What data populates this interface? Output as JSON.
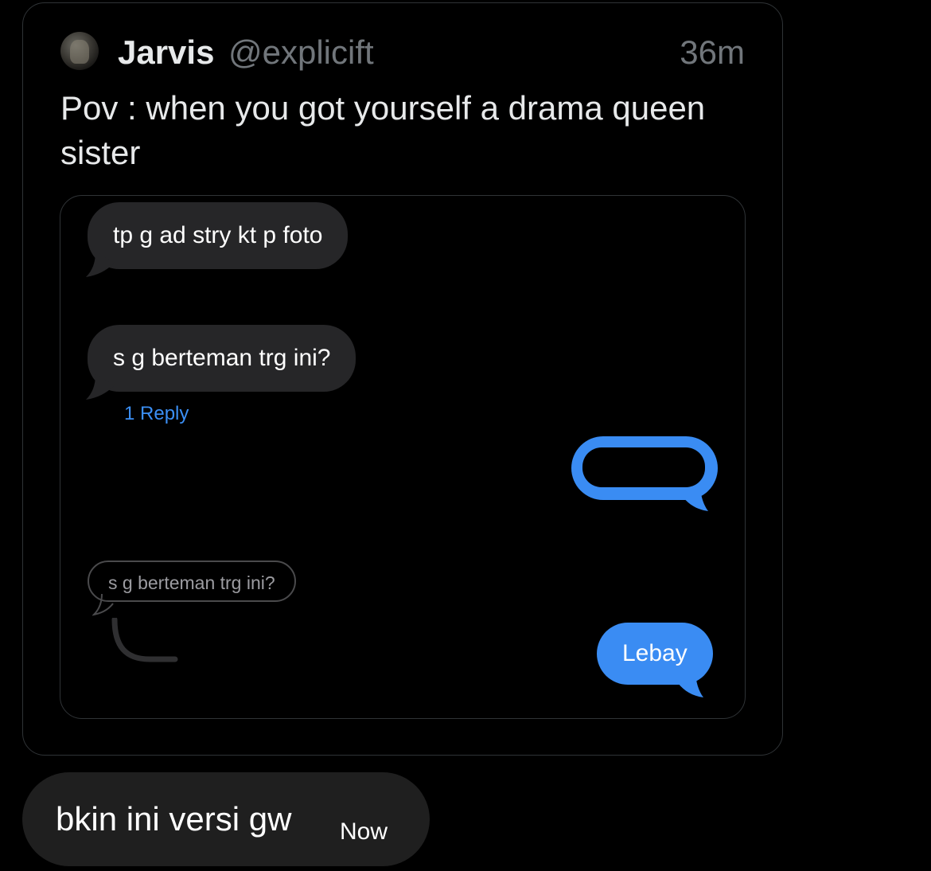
{
  "tweet": {
    "author_name": "Jarvis",
    "author_handle": "@explicift",
    "time_ago": "36m",
    "text": "Pov : when you got yourself a drama queen sister"
  },
  "media_screenshot": {
    "messages": [
      {
        "text": "tp g ad stry kt p foto",
        "direction": "incoming"
      },
      {
        "text": "s g berteman trg ini?",
        "direction": "incoming"
      },
      {
        "text": "",
        "direction": "outgoing",
        "redacted": true
      },
      {
        "text": "Lebay",
        "direction": "outgoing"
      }
    ],
    "reply_count_label": "1 Reply",
    "quoted_message": "s g berteman trg ini?",
    "colors": {
      "incoming_bubble": "#262628",
      "outgoing_bubble": "#3a8cf3",
      "link": "#3b8ff5"
    }
  },
  "dm_message": {
    "text": "bkin ini versi gw",
    "time": "Now"
  }
}
